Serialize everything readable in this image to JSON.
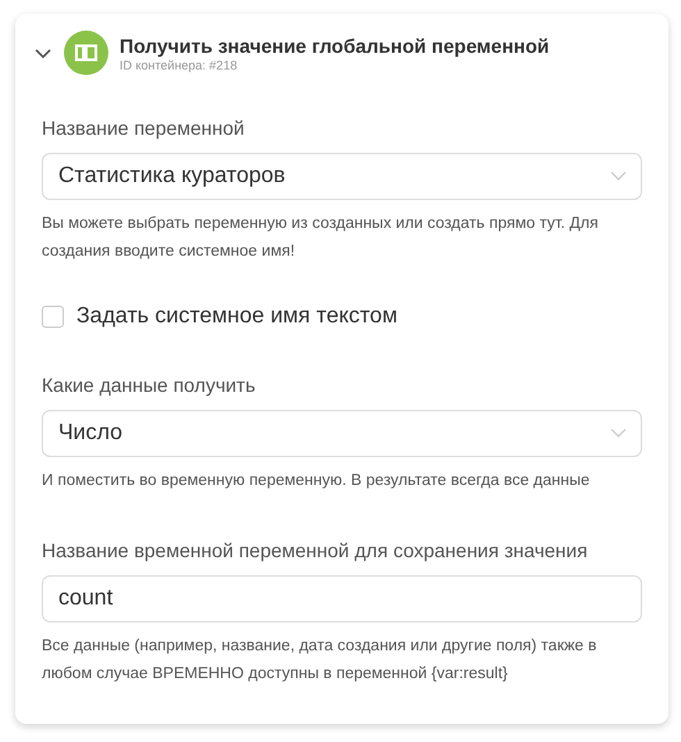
{
  "header": {
    "expanded": true,
    "title": "Получить значение глобальной переменной",
    "subtitle": "ID контейнера: #218"
  },
  "fields": [
    {
      "kind": "select",
      "label": "Название переменной",
      "value": "Статистика кураторов",
      "help": "Вы можете выбрать переменную из созданных или создать прямо тут. Для создания вводите системное имя!"
    },
    {
      "kind": "checkbox",
      "label": "Задать системное имя текстом",
      "checked": false
    },
    {
      "kind": "select",
      "label": "Какие данные получить",
      "value": "Число",
      "help": "И поместить во временную переменную. В результате всегда все данные"
    },
    {
      "kind": "input",
      "label": "Название временной переменной для сохранения значения",
      "value": "count",
      "help": "Все данные (например, название, дата создания или другие поля) также в любом случае ВРЕМЕННО доступны в переменной {var:result}"
    }
  ]
}
